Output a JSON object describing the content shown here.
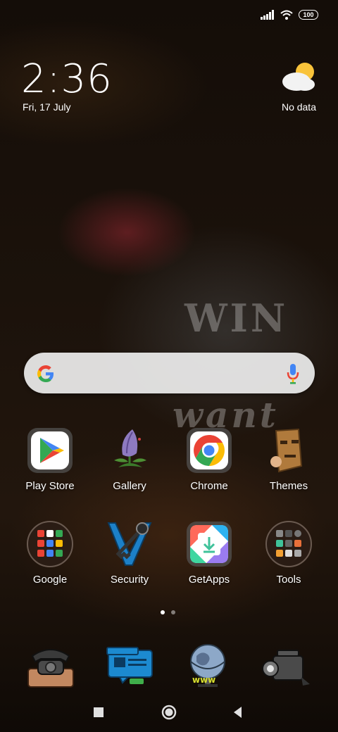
{
  "status_bar": {
    "battery": "100",
    "icons": [
      "signal-icon",
      "wifi-icon",
      "battery-icon"
    ]
  },
  "clock": {
    "time": "2:36",
    "date": "Fri, 17 July"
  },
  "weather": {
    "text": "No data",
    "icon": "partly-cloudy-icon"
  },
  "wallpaper": {
    "mug_text": [
      "WIN",
      "want"
    ]
  },
  "search_bar": {
    "icons": [
      "google-logo-icon",
      "microphone-icon"
    ]
  },
  "apps": [
    {
      "label": "Play Store"
    },
    {
      "label": "Gallery"
    },
    {
      "label": "Chrome"
    },
    {
      "label": "Themes"
    },
    {
      "label": "Google"
    },
    {
      "label": "Security"
    },
    {
      "label": "GetApps"
    },
    {
      "label": "Tools"
    }
  ],
  "page_indicator": {
    "pages": 2,
    "current": 1
  },
  "dock": {
    "icons": [
      "phone-icon",
      "messages-icon",
      "browser-icon",
      "camera-icon"
    ]
  },
  "nav_bar": {
    "icons": [
      "recents-icon",
      "home-icon",
      "back-icon"
    ]
  },
  "colors": {
    "google_blue": "#4285F4",
    "google_red": "#EA4335",
    "google_yellow": "#FBBC05",
    "google_green": "#34A853"
  }
}
